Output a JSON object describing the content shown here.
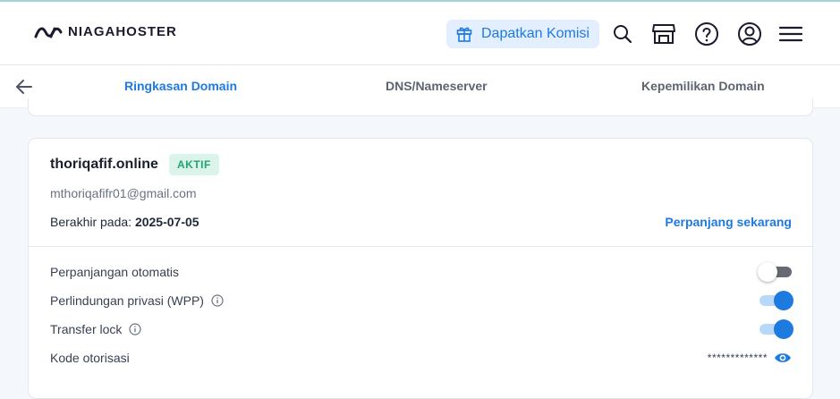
{
  "header": {
    "logo_text": "NIAGAHOSTER",
    "komisi_label": "Dapatkan Komisi",
    "icons": [
      "gift-icon",
      "search-icon",
      "store-icon",
      "help-icon",
      "account-icon",
      "menu-icon"
    ]
  },
  "tabs": [
    {
      "label": "Ringkasan Domain",
      "active": true
    },
    {
      "label": "DNS/Nameserver",
      "active": false
    },
    {
      "label": "Kepemilikan Domain",
      "active": false
    }
  ],
  "domain": {
    "name": "thoriqafif.online",
    "status": "AKTIF",
    "email": "mthoriqafifr01@gmail.com",
    "expiry_label": "Berakhir pada:",
    "expiry_date": "2025-07-05",
    "renew_label": "Perpanjang sekarang"
  },
  "settings": {
    "auto_renew": {
      "label": "Perpanjangan otomatis",
      "enabled": false
    },
    "privacy": {
      "label": "Perlindungan privasi (WPP)",
      "enabled": true
    },
    "transfer_lock": {
      "label": "Transfer lock",
      "enabled": true
    },
    "auth_code": {
      "label": "Kode otorisasi",
      "masked_value": "*************"
    }
  },
  "colors": {
    "accent": "#1f7ae0",
    "badge_bg": "#dcf3ea",
    "badge_text": "#1ea67a"
  }
}
